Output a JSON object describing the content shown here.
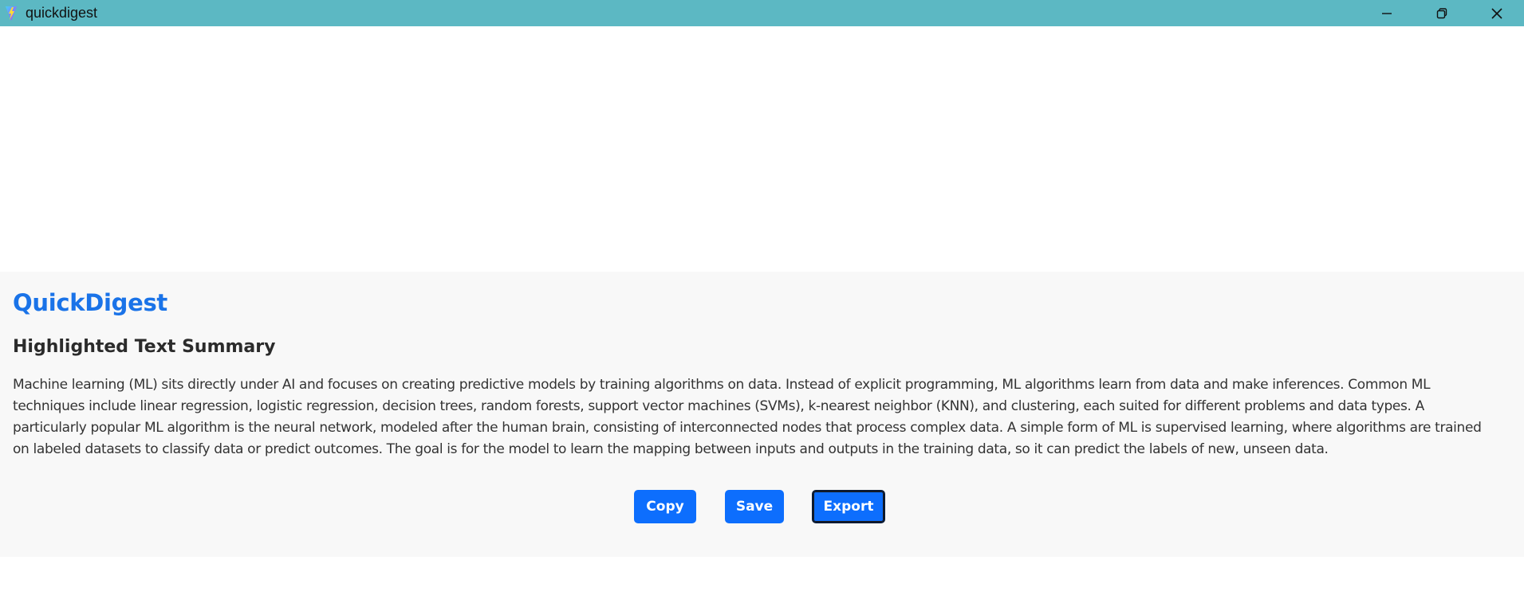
{
  "window": {
    "title": "quickdigest",
    "icon": "vite-logo-icon",
    "controls": [
      "minimize-icon",
      "restore-icon",
      "close-icon"
    ]
  },
  "app": {
    "brand": "QuickDigest",
    "heading": "Highlighted Text Summary",
    "summary": "Machine learning (ML) sits directly under AI and focuses on creating predictive models by training algorithms on data. Instead of explicit programming, ML algorithms learn from data and make inferences. Common ML techniques include linear regression, logistic regression, decision trees, random forests, support vector machines (SVMs), k-nearest neighbor (KNN), and clustering, each suited for different problems and data types. A particularly popular ML algorithm is the neural network, modeled after the human brain, consisting of interconnected nodes that process complex data. A simple form of ML is supervised learning, where algorithms are trained on labeled datasets to classify data or predict outcomes. The goal is for the model to learn the mapping between inputs and outputs in the training data, so it can predict the labels of new, unseen data."
  },
  "actions": {
    "copy_label": "Copy",
    "save_label": "Save",
    "export_label": "Export"
  },
  "colors": {
    "titlebar": "#5cb8c3",
    "brand": "#1a73e8",
    "button": "#0d6efd",
    "panel": "#f8f8f8"
  }
}
